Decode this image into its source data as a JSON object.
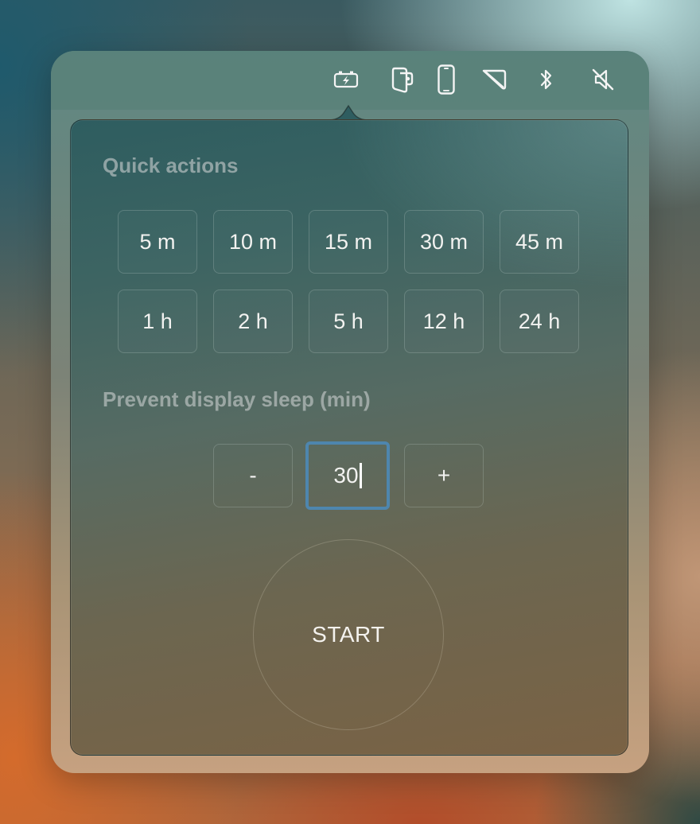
{
  "menubar": {
    "icons": [
      {
        "name": "battery-charging-icon"
      },
      {
        "name": "wallet-icon"
      },
      {
        "name": "phone-icon"
      },
      {
        "name": "cursor-tag-icon"
      },
      {
        "name": "bluetooth-icon"
      },
      {
        "name": "speaker-muted-icon"
      }
    ]
  },
  "quick_actions": {
    "title": "Quick actions",
    "buttons": [
      "5 m",
      "10 m",
      "15 m",
      "30 m",
      "45 m",
      "1 h",
      "2 h",
      "5 h",
      "12 h",
      "24 h"
    ]
  },
  "display_sleep": {
    "title": "Prevent display sleep (min)",
    "minus_label": "-",
    "value": "30",
    "plus_label": "+"
  },
  "start_label": "START",
  "colors": {
    "accent_focus": "#4e86ae",
    "text": "#f2f2f0"
  }
}
